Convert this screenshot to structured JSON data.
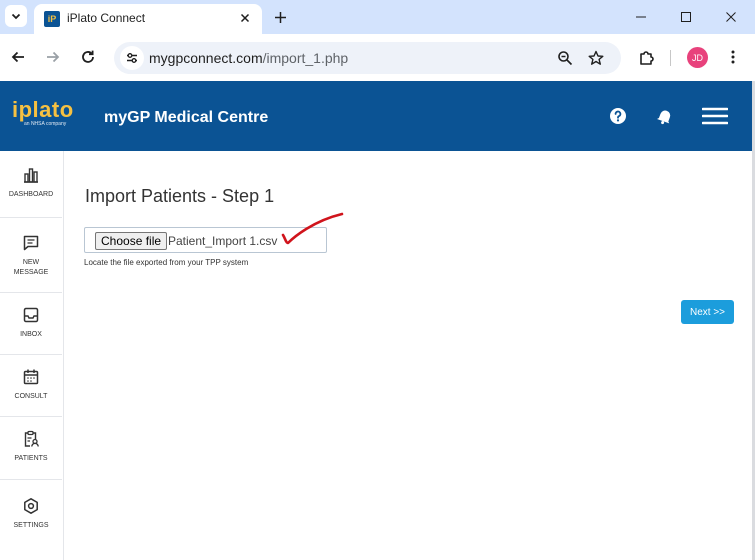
{
  "browser": {
    "tab_title": "iPlato Connect",
    "tab_favicon_text": "iP",
    "url_host": "mygpconnect.com",
    "url_path": "/import_1.php",
    "profile_initials": "JD"
  },
  "header": {
    "logo_text": "iplato",
    "logo_tagline": "an NHSA company",
    "practice_name": "myGP Medical Centre"
  },
  "sidebar": {
    "items": [
      {
        "label": "DASHBOARD",
        "icon": "bar-chart-icon"
      },
      {
        "label": "NEW MESSAGE",
        "icon": "message-icon"
      },
      {
        "label": "INBOX",
        "icon": "inbox-icon"
      },
      {
        "label": "CONSULT",
        "icon": "calendar-icon"
      },
      {
        "label": "PATIENTS",
        "icon": "clipboard-user-icon"
      },
      {
        "label": "SETTINGS",
        "icon": "gear-icon"
      }
    ]
  },
  "main": {
    "title": "Import Patients - Step 1",
    "choose_file_label": "Choose file",
    "file_name": "Patient_Import 1.csv",
    "helper_text": "Locate the file exported from your TPP system",
    "next_label": "Next >>"
  },
  "colors": {
    "header_bg": "#0b5394",
    "logo": "#f6c142",
    "next_button": "#1c9ddc",
    "checkmark": "#d0141c",
    "tabstrip": "#d3e3fd"
  }
}
